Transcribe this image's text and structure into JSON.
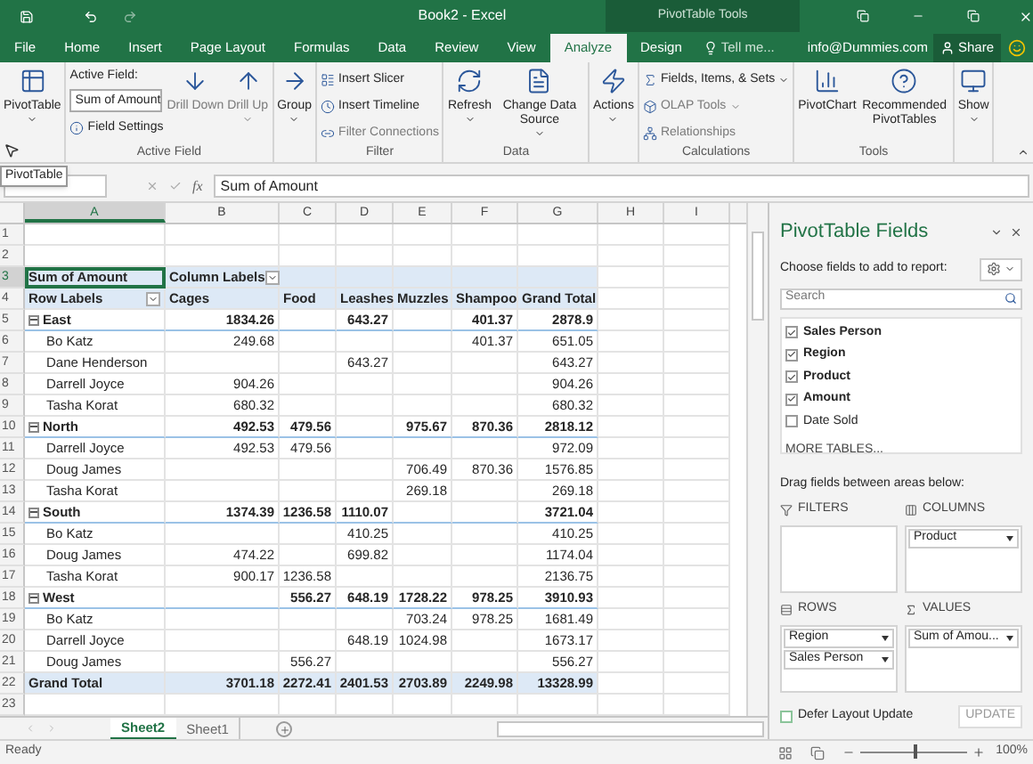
{
  "title_bar": {
    "title": "Book2 - Excel",
    "context": "PivotTable Tools"
  },
  "menu_tabs": [
    {
      "label": "File",
      "selected": false
    },
    {
      "label": "Home",
      "selected": false
    },
    {
      "label": "Insert",
      "selected": false
    },
    {
      "label": "Page Layout",
      "selected": false
    },
    {
      "label": "Formulas",
      "selected": false
    },
    {
      "label": "Data",
      "selected": false
    },
    {
      "label": "Review",
      "selected": false
    },
    {
      "label": "View",
      "selected": false
    },
    {
      "label": "Analyze",
      "selected": true
    },
    {
      "label": "Design",
      "selected": false
    }
  ],
  "tell_me": {
    "placeholder": "Tell me..."
  },
  "account": "info@Dummies.com",
  "share": "Share",
  "ribbon": [
    {
      "items": [
        {
          "kind": "large",
          "label": "PivotTable",
          "dropdown": true,
          "disabled": false
        }
      ]
    },
    {
      "label": "Active Field",
      "items": [
        {
          "kind": "caption",
          "label": "Active Field:"
        },
        {
          "kind": "field",
          "value": "Sum of Amount"
        },
        {
          "kind": "small",
          "label": "Field Settings",
          "disabled": false
        },
        {
          "kind": "large",
          "label": "Drill Down",
          "disabled": true
        },
        {
          "kind": "large",
          "label": "Drill Up",
          "dropdown": true,
          "disabled": true
        }
      ]
    },
    {
      "items": [
        {
          "kind": "large",
          "label": "Group",
          "dropdown": true,
          "disabled": false
        }
      ]
    },
    {
      "label": "Filter",
      "items": [
        {
          "kind": "small",
          "label": "Insert Slicer",
          "disabled": false
        },
        {
          "kind": "small",
          "label": "Insert Timeline",
          "disabled": false
        },
        {
          "kind": "small",
          "label": "Filter Connections",
          "disabled": true
        }
      ]
    },
    {
      "label": "Data",
      "items": [
        {
          "kind": "large",
          "label": "Refresh",
          "dropdown": true,
          "disabled": false
        },
        {
          "kind": "large",
          "label": "Change Data Source",
          "dropdown": true,
          "disabled": false
        }
      ]
    },
    {
      "items": [
        {
          "kind": "large",
          "label": "Actions",
          "dropdown": true,
          "disabled": false
        }
      ]
    },
    {
      "label": "Calculations",
      "items": [
        {
          "kind": "small",
          "label": "Fields, Items, & Sets",
          "dropdown": true,
          "disabled": false
        },
        {
          "kind": "small",
          "label": "OLAP Tools",
          "dropdown": true,
          "disabled": true
        },
        {
          "kind": "small",
          "label": "Relationships",
          "disabled": true
        }
      ]
    },
    {
      "label": "Tools",
      "items": [
        {
          "kind": "large",
          "label": "PivotChart",
          "disabled": false
        },
        {
          "kind": "large",
          "label": "Recommended PivotTables",
          "disabled": false
        }
      ]
    },
    {
      "items": [
        {
          "kind": "large",
          "label": "Show",
          "dropdown": true,
          "disabled": false
        }
      ]
    }
  ],
  "tooltip": "PivotTable",
  "formula_bar": {
    "fx": "fx",
    "value": "Sum of Amount"
  },
  "sheet": {
    "columns": [
      "A",
      "B",
      "C",
      "D",
      "E",
      "F",
      "G",
      "H",
      "I"
    ],
    "rows": [
      {
        "number": "1",
        "kind": "blank",
        "cells": {}
      },
      {
        "number": "2",
        "kind": "blank",
        "cells": {}
      },
      {
        "number": "3",
        "kind": "corner",
        "cells": {
          "A": "Sum of Amount",
          "B": "Column Labels"
        }
      },
      {
        "number": "4",
        "kind": "header",
        "cells": {
          "A": "Row Labels",
          "B": "Cages",
          "C": "Food",
          "D": "Leashes",
          "E": "Muzzles",
          "F": "Shampoo",
          "G": "Grand Total"
        }
      },
      {
        "number": "5",
        "kind": "region",
        "expanded": true,
        "cells": {
          "A": "East",
          "B": "1834.26",
          "D": "643.27",
          "F": "401.37",
          "G": "2878.9"
        }
      },
      {
        "number": "6",
        "kind": "person",
        "cells": {
          "A": "Bo Katz",
          "B": "249.68",
          "F": "401.37",
          "G": "651.05"
        }
      },
      {
        "number": "7",
        "kind": "person",
        "cells": {
          "A": "Dane Henderson",
          "D": "643.27",
          "G": "643.27"
        }
      },
      {
        "number": "8",
        "kind": "person",
        "cells": {
          "A": "Darrell Joyce",
          "B": "904.26",
          "G": "904.26"
        }
      },
      {
        "number": "9",
        "kind": "person",
        "cells": {
          "A": "Tasha Korat",
          "B": "680.32",
          "G": "680.32"
        }
      },
      {
        "number": "10",
        "kind": "region",
        "expanded": true,
        "cells": {
          "A": "North",
          "B": "492.53",
          "C": "479.56",
          "E": "975.67",
          "F": "870.36",
          "G": "2818.12"
        }
      },
      {
        "number": "11",
        "kind": "person",
        "cells": {
          "A": "Darrell Joyce",
          "B": "492.53",
          "C": "479.56",
          "G": "972.09"
        }
      },
      {
        "number": "12",
        "kind": "person",
        "cells": {
          "A": "Doug James",
          "E": "706.49",
          "F": "870.36",
          "G": "1576.85"
        }
      },
      {
        "number": "13",
        "kind": "person",
        "cells": {
          "A": "Tasha Korat",
          "E": "269.18",
          "G": "269.18"
        }
      },
      {
        "number": "14",
        "kind": "region",
        "expanded": true,
        "cells": {
          "A": "South",
          "B": "1374.39",
          "C": "1236.58",
          "D": "1110.07",
          "G": "3721.04"
        }
      },
      {
        "number": "15",
        "kind": "person",
        "cells": {
          "A": "Bo Katz",
          "D": "410.25",
          "G": "410.25"
        }
      },
      {
        "number": "16",
        "kind": "person",
        "cells": {
          "A": "Doug James",
          "B": "474.22",
          "D": "699.82",
          "G": "1174.04"
        }
      },
      {
        "number": "17",
        "kind": "person",
        "cells": {
          "A": "Tasha Korat",
          "B": "900.17",
          "C": "1236.58",
          "G": "2136.75"
        }
      },
      {
        "number": "18",
        "kind": "region",
        "expanded": true,
        "cells": {
          "A": "West",
          "C": "556.27",
          "D": "648.19",
          "E": "1728.22",
          "F": "978.25",
          "G": "3910.93"
        }
      },
      {
        "number": "19",
        "kind": "person",
        "cells": {
          "A": "Bo Katz",
          "E": "703.24",
          "F": "978.25",
          "G": "1681.49"
        }
      },
      {
        "number": "20",
        "kind": "person",
        "cells": {
          "A": "Darrell Joyce",
          "D": "648.19",
          "E": "1024.98",
          "G": "1673.17"
        }
      },
      {
        "number": "21",
        "kind": "person",
        "cells": {
          "A": "Doug James",
          "C": "556.27",
          "G": "556.27"
        }
      },
      {
        "number": "22",
        "kind": "total",
        "cells": {
          "A": "Grand Total",
          "B": "3701.18",
          "C": "2272.41",
          "D": "2401.53",
          "E": "2703.89",
          "F": "2249.98",
          "G": "13328.99"
        }
      },
      {
        "number": "23",
        "kind": "blank",
        "cells": {}
      }
    ]
  },
  "sheet_tabs": [
    {
      "label": "Sheet2",
      "selected": true
    },
    {
      "label": "Sheet1",
      "selected": false
    }
  ],
  "pane": {
    "title": "PivotTable Fields",
    "subtitle": "Choose fields to add to report:",
    "search": {
      "placeholder": "Search"
    },
    "fields": [
      {
        "label": "Sales Person",
        "checked": true
      },
      {
        "label": "Region",
        "checked": true
      },
      {
        "label": "Product",
        "checked": true
      },
      {
        "label": "Amount",
        "checked": true
      },
      {
        "label": "Date Sold",
        "checked": false
      }
    ],
    "more": "MORE TABLES...",
    "drag_hint": "Drag fields between areas below:",
    "areas": [
      {
        "kind": "filters",
        "label": "FILTERS"
      },
      {
        "kind": "columns",
        "label": "COLUMNS",
        "items": [
          "Product"
        ]
      },
      {
        "kind": "rows",
        "label": "ROWS",
        "items": [
          "Region",
          "Sales Person"
        ]
      },
      {
        "kind": "values",
        "label": "VALUES",
        "items": [
          "Sum of Amou..."
        ]
      }
    ],
    "defer": {
      "label": "Defer Layout Update",
      "checked": false
    },
    "update": {
      "label": "UPDATE",
      "disabled": true
    }
  },
  "status_bar": {
    "text": "Ready",
    "zoom": {
      "level": 0.5,
      "reading": "100%"
    }
  }
}
